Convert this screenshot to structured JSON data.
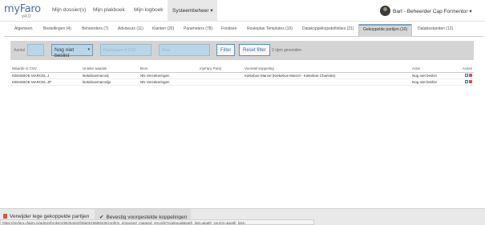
{
  "app": {
    "brand": "myFaro",
    "version": "v4.0"
  },
  "nav": {
    "items": [
      "Mijn dossier(s)",
      "Mijn plakboek",
      "Mijn logboek"
    ],
    "active": "Systeembeheer ▾",
    "user": "Bart - Beheerder Cap Formentor ▾"
  },
  "tabs": [
    "Algemeen",
    "Bestellingen (4)",
    "Beheerders (7)",
    "Adviseurs (11)",
    "Klanten (20)",
    "Parameters (78)",
    "Fondsen",
    "Rouleplan Templates (10)",
    "Datakoppelingsdefinities (21)",
    "Gekoppelde partijen (10)",
    "Databestanden (12)"
  ],
  "filter": {
    "label": "Aantal",
    "select_value": "Nog niet beslist",
    "input1_placeholder": "Klantnaam of CSV",
    "input2_placeholder": "Bron",
    "filter_label": "Filter",
    "reset_label": "Reset filter",
    "row_count": "2 rijen gevonden"
  },
  "table": {
    "headers": [
      "Waarde in CSV",
      "Unieke waarde",
      "Bron",
      "myFaro Partij",
      "Voorstel koppeling",
      "Actie",
      "Acties"
    ],
    "rows": [
      [
        "KIEKEBOE MARCEL J",
        "kiekeboemarcelj",
        "NN Verzekeringen",
        "",
        "Kiekeboe Marcel (Kiekeboe Marcel - Kiekeboe Charlotte)",
        "Nog niet beslist"
      ],
      [
        "KIEKEBOE MARCEL JP",
        "kiekeboemarceljp",
        "NN Verzekeringen",
        "",
        "",
        "Nog niet beslist"
      ]
    ]
  },
  "bottom": {
    "delete_label": "Verwijder lege gekoppelde partijen",
    "confirm_label": "Bevestig voorgestelde koppelingen"
  },
  "status_url": "https://myfaro.cfaprs.io/admin/brokers/96454d43f48a0018588340/confirm_proposed_mapped_records?scaleuuid&path_last=&path_source=&path_last="
}
